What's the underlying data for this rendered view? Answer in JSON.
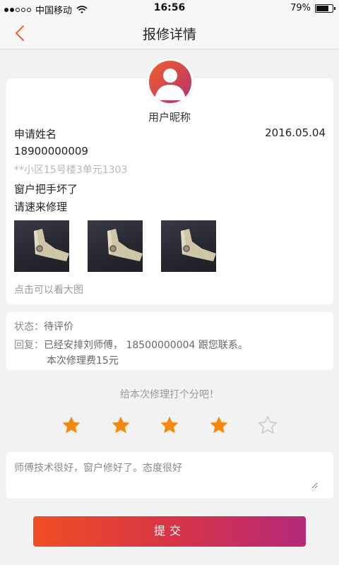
{
  "status_bar": {
    "carrier": "中国移动",
    "time": "16:56",
    "battery": "79%",
    "battery_level": 0.79
  },
  "nav": {
    "title": "报修详情"
  },
  "repair": {
    "nickname": "用户昵称",
    "applicant_name": "申请姓名",
    "date": "2016.05.04",
    "phone": "18900000009",
    "address": "**小区15号楼3单元1303",
    "issue": "窗户把手坏了",
    "request": "请速来修理",
    "image_hint": "点击可以看大图",
    "image_count": 3
  },
  "status": {
    "status_label": "状态：",
    "status_value": "待评价",
    "reply_label": "回复：",
    "reply_line1": "已经安排刘师傅， 18500000004 跟您联系。",
    "reply_line2": "本次修理费15元"
  },
  "rating": {
    "prompt": "给本次修理打个分吧！",
    "value": 4,
    "max": 5,
    "color_filled": "#f5880f",
    "color_empty": "#c8c8c8"
  },
  "comment": {
    "value": "师傅技术很好，窗户修好了。态度很好"
  },
  "submit": {
    "label": "提交"
  }
}
